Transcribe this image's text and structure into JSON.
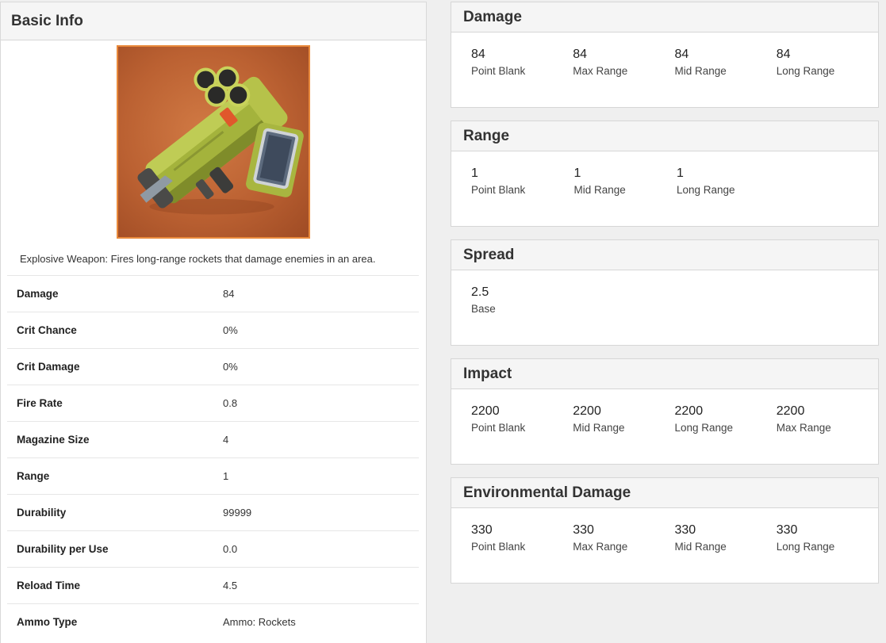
{
  "basic_info": {
    "title": "Basic Info",
    "image_alt": "quad-launcher-weapon-image",
    "description": "Explosive Weapon: Fires long-range rockets that damage enemies in an area.",
    "stats": [
      {
        "label": "Damage",
        "value": "84"
      },
      {
        "label": "Crit Chance",
        "value": "0%"
      },
      {
        "label": "Crit Damage",
        "value": "0%"
      },
      {
        "label": "Fire Rate",
        "value": "0.8"
      },
      {
        "label": "Magazine Size",
        "value": "4"
      },
      {
        "label": "Range",
        "value": "1"
      },
      {
        "label": "Durability",
        "value": "99999"
      },
      {
        "label": "Durability per Use",
        "value": "0.0"
      },
      {
        "label": "Reload Time",
        "value": "4.5"
      },
      {
        "label": "Ammo Type",
        "value": "Ammo: Rockets"
      }
    ]
  },
  "cards": {
    "damage": {
      "title": "Damage",
      "metrics": [
        {
          "value": "84",
          "label": "Point Blank"
        },
        {
          "value": "84",
          "label": "Max Range"
        },
        {
          "value": "84",
          "label": "Mid Range"
        },
        {
          "value": "84",
          "label": "Long Range"
        }
      ]
    },
    "range": {
      "title": "Range",
      "metrics": [
        {
          "value": "1",
          "label": "Point Blank"
        },
        {
          "value": "1",
          "label": "Mid Range"
        },
        {
          "value": "1",
          "label": "Long Range"
        }
      ]
    },
    "spread": {
      "title": "Spread",
      "metrics": [
        {
          "value": "2.5",
          "label": "Base"
        }
      ]
    },
    "impact": {
      "title": "Impact",
      "metrics": [
        {
          "value": "2200",
          "label": "Point Blank"
        },
        {
          "value": "2200",
          "label": "Mid Range"
        },
        {
          "value": "2200",
          "label": "Long Range"
        },
        {
          "value": "2200",
          "label": "Max Range"
        }
      ]
    },
    "environmental_damage": {
      "title": "Environmental Damage",
      "metrics": [
        {
          "value": "330",
          "label": "Point Blank"
        },
        {
          "value": "330",
          "label": "Max Range"
        },
        {
          "value": "330",
          "label": "Mid Range"
        },
        {
          "value": "330",
          "label": "Long Range"
        }
      ]
    }
  },
  "colors": {
    "page_background": "#efefef",
    "panel_background": "#ffffff",
    "header_background": "#f5f5f5",
    "border": "#d6d6d6",
    "image_border": "#e98a3c",
    "image_background": "#bb6132",
    "weapon_green": "#9fae3a"
  }
}
